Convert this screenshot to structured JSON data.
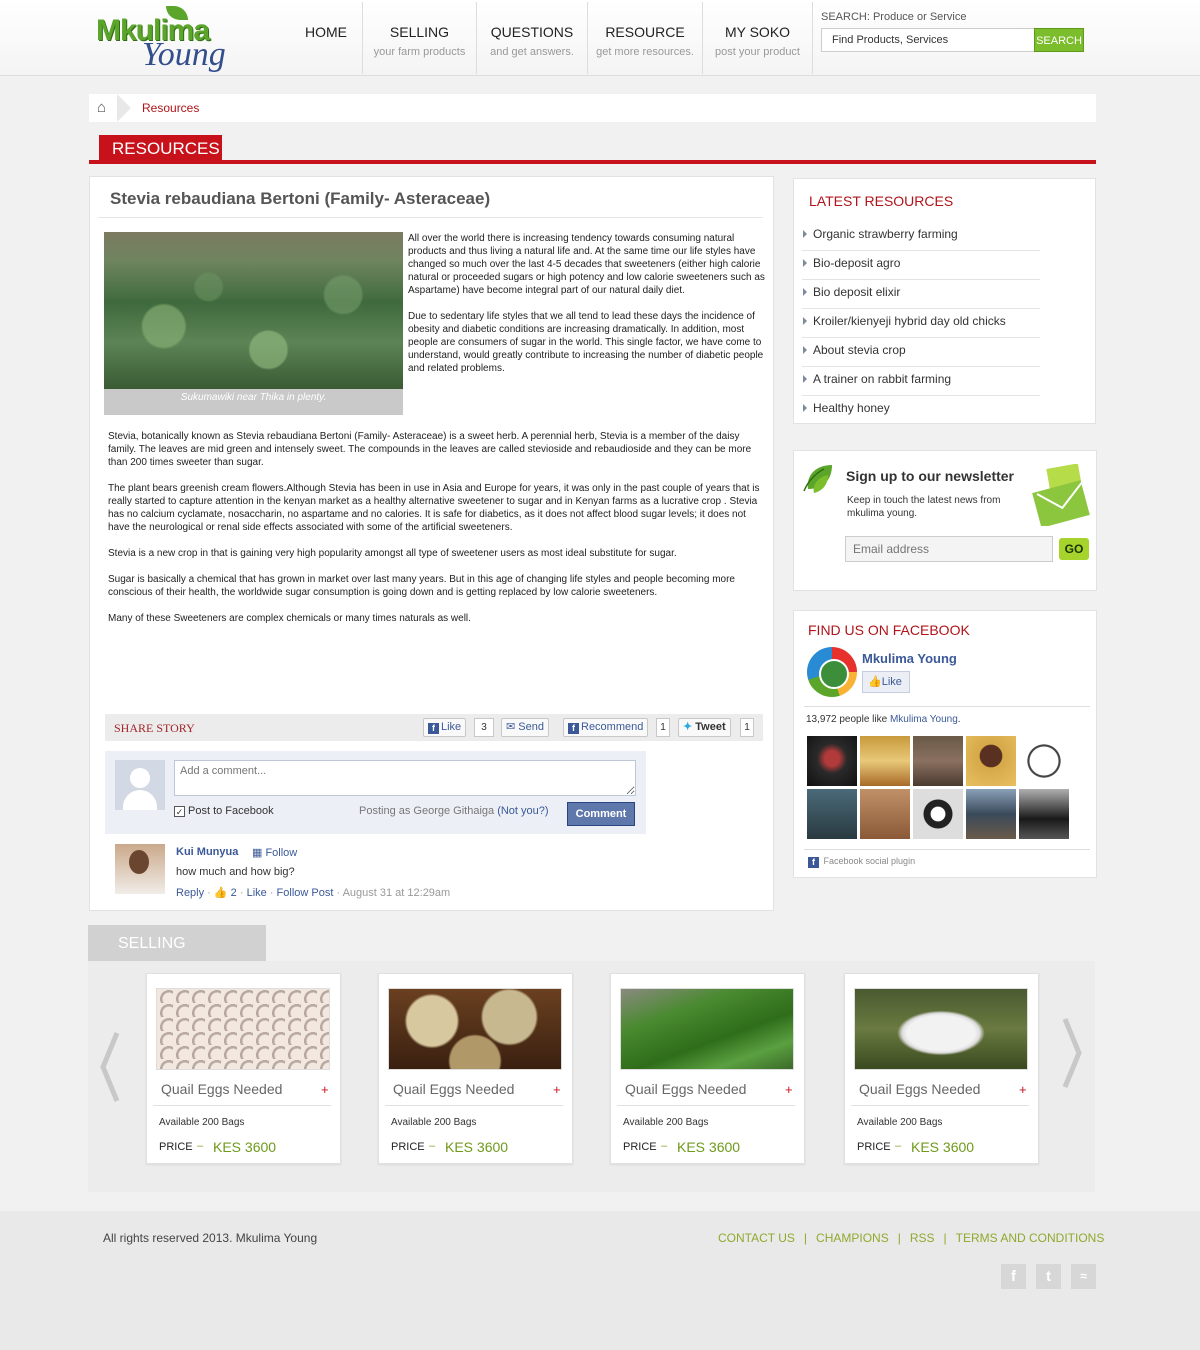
{
  "header": {
    "logo_top": "Mkulima",
    "logo_bottom": "Young",
    "nav": [
      {
        "title": "HOME",
        "sub": ""
      },
      {
        "title": "SELLING",
        "sub": "your farm products"
      },
      {
        "title": "QUESTIONS",
        "sub": "and get answers."
      },
      {
        "title": "RESOURCE",
        "sub": "get more resources."
      },
      {
        "title": "MY SOKO",
        "sub": "post your product"
      }
    ],
    "search_label": "SEARCH: Produce or Service",
    "search_value": "Find Products, Services",
    "search_button": "SEARCH"
  },
  "breadcrumb": {
    "current": "Resources"
  },
  "section_title": "RESOURCES",
  "article": {
    "title": "Stevia rebaudiana Bertoni (Family- Asteraceae)",
    "photo_caption": "Sukumawiki near Thika in plenty.",
    "intro": [
      "All over the world there is increasing tendency towards consuming natural products and thus living a natural life and. At the same time our life styles have changed so much over the last 4-5 decades that sweeteners (either high calorie natural or proceeded sugars or high potency and low calorie sweeteners such as Aspartame) have become integral part of our natural daily diet.",
      "Due to sedentary life styles that we all tend to lead these days the incidence of obesity and diabetic conditions are increasing dramatically. In addition, most people are consumers of sugar in the world. This single factor, we have come to understand, would greatly contribute to increasing the number of diabetic people and related problems."
    ],
    "body": [
      "Stevia, botanically known as Stevia rebaudiana Bertoni (Family- Asteraceae) is a sweet herb. A perennial herb, Stevia is a member of the daisy family. The leaves are mid green and intensely sweet. The compounds in the leaves are called stevioside and rebaudioside and they can be more than 200 times sweeter than sugar.",
      "The plant bears greenish cream flowers.Although Stevia has been in use in Asia and Europe for years, it was only in the past couple of years that is really started to capture attention in the kenyan market as a healthy alternative sweetener to sugar and in Kenyan farms as a lucrative crop . Stevia has no calcium cyclamate, nosaccharin, no aspartame and no calories. It is safe for diabetics, as it does not affect blood sugar levels; it does not have the neurological or renal side effects associated with some of the artificial sweeteners.",
      "Stevia is a new crop in that is gaining very high popularity amongst all type of sweetener users as most ideal substitute for sugar.",
      "Sugar is basically a chemical that has grown in market over last many years. But in this age of changing life styles and people becoming more conscious of their health, the worldwide sugar consumption is going down and is getting replaced by low calorie sweeteners.",
      "Many of these Sweeteners are complex chemicals or many times naturals as well."
    ]
  },
  "share": {
    "label": "SHARE STORY",
    "like": "Like",
    "like_count": "3",
    "send": "Send",
    "recommend": "Recommend",
    "recommend_count": "1",
    "tweet": "Tweet",
    "tweet_count": "1"
  },
  "comment_box": {
    "placeholder": "Add a comment...",
    "post_to_fb": "Post to Facebook",
    "posting_as": "Posting as George Githaiga",
    "not_you": "(Not you?)",
    "button": "Comment"
  },
  "comment": {
    "author": "Kui Munyua",
    "follow": "Follow",
    "text": "how much and how big?",
    "reply": "Reply",
    "likes": "2",
    "like": "Like",
    "follow_post": "Follow Post",
    "time": "August 31 at 12:29am"
  },
  "latest": {
    "title": "LATEST RESOURCES",
    "items": [
      "Organic strawberry farming",
      "Bio-deposit agro",
      "Bio deposit elixir",
      "Kroiler/kienyeji hybrid day old chicks",
      "About stevia crop",
      "A trainer on rabbit farming",
      "Healthy honey"
    ]
  },
  "newsletter": {
    "title": "Sign up to our newsletter",
    "desc": "Keep in touch the latest news from mkulima young.",
    "placeholder": "Email address",
    "button": "GO"
  },
  "facebook": {
    "title": "FIND US ON FACEBOOK",
    "page_name": "Mkulima Young",
    "like": "Like",
    "count_text": "13,972 people like",
    "count_link": "Mkulima Young",
    "plugin": "Facebook social plugin"
  },
  "selling": {
    "title": "SELLING",
    "cards": [
      {
        "title": "Quail Eggs Needed",
        "avail": "Available 200 Bags",
        "price_label": "PRICE",
        "price": "KES 3600"
      },
      {
        "title": "Quail Eggs Needed",
        "avail": "Available 200 Bags",
        "price_label": "PRICE",
        "price": "KES 3600"
      },
      {
        "title": "Quail Eggs Needed",
        "avail": "Available 200 Bags",
        "price_label": "PRICE",
        "price": "KES 3600"
      },
      {
        "title": "Quail Eggs Needed",
        "avail": "Available 200 Bags",
        "price_label": "PRICE",
        "price": "KES 3600"
      }
    ]
  },
  "footer": {
    "copyright": "All rights reserved 2013. Mkulima Young",
    "links": [
      "CONTACT US",
      "CHAMPIONS",
      "RSS",
      "TERMS AND CONDITIONS"
    ]
  },
  "colors": {
    "brand_red": "#c8121b",
    "brand_green": "#7cbd2c",
    "fb_blue": "#3b5998"
  }
}
